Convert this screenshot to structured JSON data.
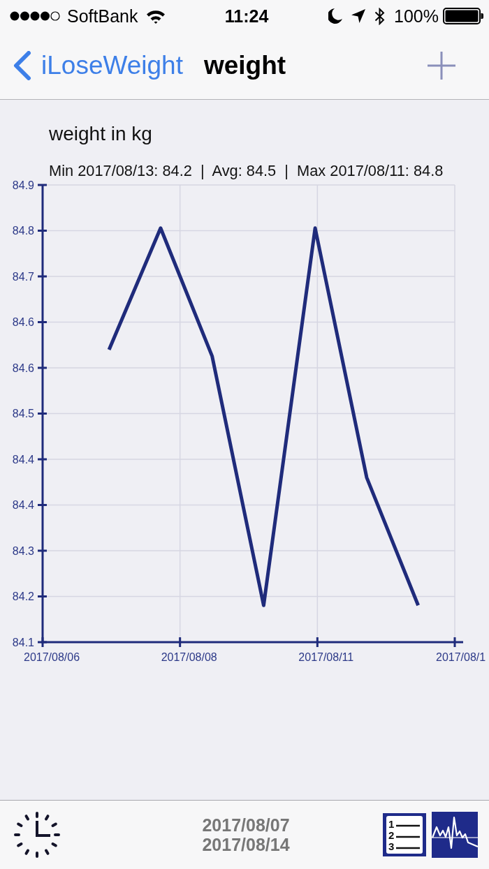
{
  "status_bar": {
    "carrier": "SoftBank",
    "time": "11:24",
    "battery": "100%"
  },
  "nav_bar": {
    "back": "iLoseWeight",
    "title": "weight"
  },
  "chart": {
    "summary": "Min 2017/08/13: 84.2  |  Avg: 84.5  |  Max 2017/08/11: 84.8",
    "x_axis_labels": [
      "2017/08/06",
      "2017/08/08",
      "2017/08/11",
      "2017/08/1"
    ],
    "chart_data": {
      "type": "line",
      "title": "weight in kg",
      "grid": true,
      "categories": [
        null,
        null,
        null,
        null,
        null,
        null,
        null
      ],
      "series": [
        {
          "color": "#1f2b7b",
          "values": [
            84.6,
            84.79,
            84.59,
            84.2,
            84.79,
            84.4,
            84.2
          ]
        }
      ],
      "ylim": [
        84.1425,
        84.8575
      ],
      "yticks": [
        {
          "value": 84.1425,
          "label": "84.1"
        },
        {
          "value": 84.214,
          "label": "84.2"
        },
        {
          "value": 84.2855,
          "label": "84.3"
        },
        {
          "value": 84.357,
          "label": "84.4"
        },
        {
          "value": 84.4285,
          "label": "84.4"
        },
        {
          "value": 84.5,
          "label": "84.5"
        },
        {
          "value": 84.5715,
          "label": "84.6"
        },
        {
          "value": 84.643,
          "label": "84.6"
        },
        {
          "value": 84.7145,
          "label": "84.7"
        },
        {
          "value": 84.786,
          "label": "84.8"
        },
        {
          "value": 84.8575,
          "label": "84.9"
        }
      ]
    }
  },
  "toolbar": {
    "date_range": [
      "2017/08/07",
      "2017/08/14"
    ],
    "buttons": [
      {
        "kind": "list",
        "numbers": [
          "1",
          "2",
          "3"
        ]
      },
      {
        "kind": "chart"
      }
    ]
  }
}
